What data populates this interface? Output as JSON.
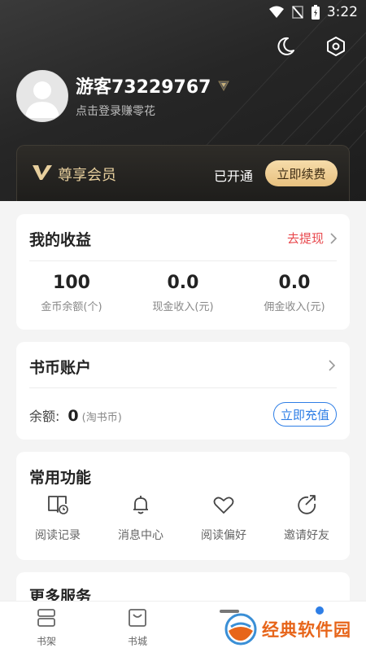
{
  "status_bar": {
    "time": "3:22"
  },
  "profile": {
    "username": "游客73229767",
    "login_hint": "点击登录赚零花"
  },
  "vip": {
    "title": "尊享会员",
    "status": "已开通",
    "renew_label": "立即续费"
  },
  "earnings": {
    "title": "我的收益",
    "withdraw_label": "去提现",
    "stats": [
      {
        "value": "100",
        "label": "金币余额(个)"
      },
      {
        "value": "0.0",
        "label": "现金收入(元)"
      },
      {
        "value": "0.0",
        "label": "佣金收入(元)"
      }
    ]
  },
  "coin_account": {
    "title": "书币账户",
    "balance_label": "余额:",
    "balance_value": "0",
    "balance_unit": "(淘书币)",
    "recharge_label": "立即充值"
  },
  "features": {
    "title": "常用功能",
    "items": [
      {
        "label": "阅读记录",
        "icon": "reading-history-icon"
      },
      {
        "label": "消息中心",
        "icon": "bell-icon"
      },
      {
        "label": "阅读偏好",
        "icon": "heart-icon"
      },
      {
        "label": "邀请好友",
        "icon": "share-icon"
      }
    ]
  },
  "more_services": {
    "title": "更多服务"
  },
  "tabbar": {
    "items": [
      {
        "label": "书架"
      },
      {
        "label": "书城"
      }
    ]
  },
  "watermark": {
    "text": "经典软件园"
  },
  "colors": {
    "accent_red": "#e8474c",
    "accent_blue": "#2e7ee6",
    "gold": "#e7cf9d"
  }
}
